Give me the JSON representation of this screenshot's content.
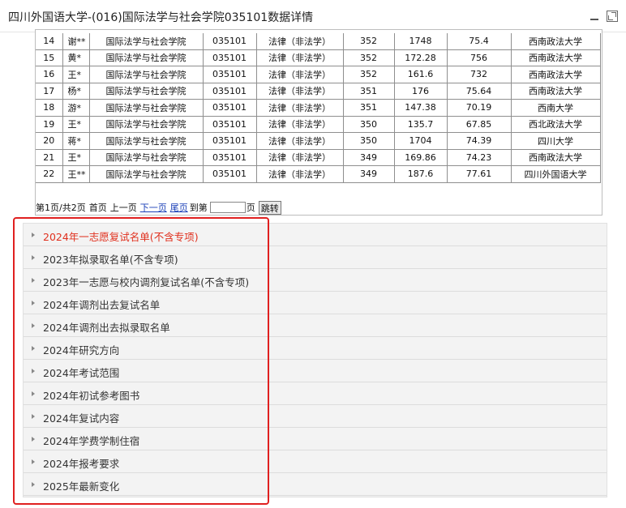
{
  "window": {
    "title": "四川外国语大学-(016)国际法学与社会学院035101数据详情"
  },
  "table": {
    "rows": [
      [
        "14",
        "谢**",
        "国际法学与社会学院",
        "035101",
        "法律（非法学）",
        "352",
        "1748",
        "75.4",
        "西南政法大学"
      ],
      [
        "15",
        "黄*",
        "国际法学与社会学院",
        "035101",
        "法律（非法学）",
        "352",
        "172.28",
        "756",
        "西南政法大学"
      ],
      [
        "16",
        "王*",
        "国际法学与社会学院",
        "035101",
        "法律（非法学）",
        "352",
        "161.6",
        "732",
        "西南政法大学"
      ],
      [
        "17",
        "杨*",
        "国际法学与社会学院",
        "035101",
        "法律（非法学）",
        "351",
        "176",
        "75.64",
        "西南政法大学"
      ],
      [
        "18",
        "游*",
        "国际法学与社会学院",
        "035101",
        "法律（非法学）",
        "351",
        "147.38",
        "70.19",
        "西南大学"
      ],
      [
        "19",
        "王*",
        "国际法学与社会学院",
        "035101",
        "法律（非法学）",
        "350",
        "135.7",
        "67.85",
        "西北政法大学"
      ],
      [
        "20",
        "蒋*",
        "国际法学与社会学院",
        "035101",
        "法律（非法学）",
        "350",
        "1704",
        "74.39",
        "四川大学"
      ],
      [
        "21",
        "王*",
        "国际法学与社会学院",
        "035101",
        "法律（非法学）",
        "349",
        "169.86",
        "74.23",
        "西南政法大学"
      ],
      [
        "22",
        "王**",
        "国际法学与社会学院",
        "035101",
        "法律（非法学）",
        "349",
        "187.6",
        "77.61",
        "四川外国语大学"
      ]
    ]
  },
  "pager": {
    "info": "第1页/共2页",
    "first": "首页",
    "prev": "上一页",
    "next": "下一页",
    "last": "尾页",
    "goto_prefix": "到第",
    "goto_suffix": "页",
    "jump": "跳转",
    "page_input": ""
  },
  "accordion": [
    {
      "label": "2024年一志愿复试名单(不含专项)",
      "active": true
    },
    {
      "label": "2023年拟录取名单(不含专项)",
      "active": false
    },
    {
      "label": "2023年一志愿与校内调剂复试名单(不含专项)",
      "active": false
    },
    {
      "label": "2024年调剂出去复试名单",
      "active": false
    },
    {
      "label": "2024年调剂出去拟录取名单",
      "active": false
    },
    {
      "label": "2024年研究方向",
      "active": false
    },
    {
      "label": "2024年考试范围",
      "active": false
    },
    {
      "label": "2024年初试参考图书",
      "active": false
    },
    {
      "label": "2024年复试内容",
      "active": false
    },
    {
      "label": "2024年学费学制住宿",
      "active": false
    },
    {
      "label": "2024年报考要求",
      "active": false
    },
    {
      "label": "2025年最新变化",
      "active": false
    }
  ],
  "colors": {
    "active": "#e0301e",
    "highlight": "#e02020"
  }
}
